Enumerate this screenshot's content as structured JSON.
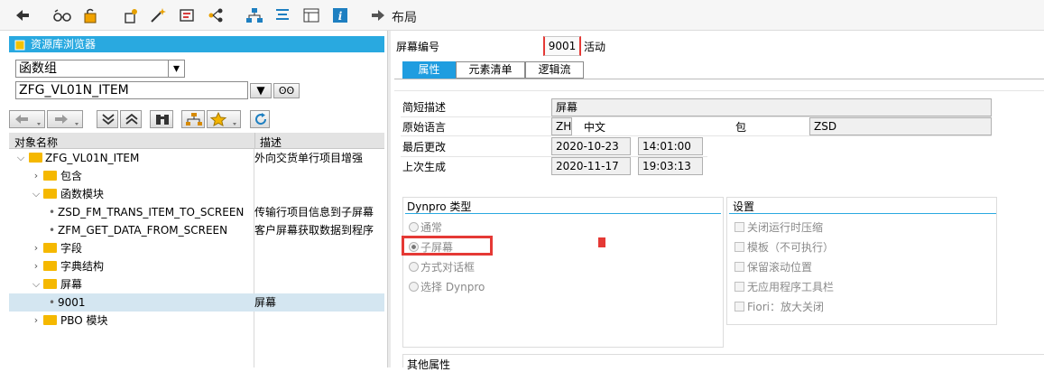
{
  "toolbar": {
    "layout_label": "布局"
  },
  "browser": {
    "title": "资源库浏览器",
    "object_type": "函数组",
    "object_name": "ZFG_VL01N_ITEM",
    "col_name": "对象名称",
    "col_desc": "描述"
  },
  "tree": {
    "root": {
      "name": "ZFG_VL01N_ITEM",
      "desc": "外向交货单行项目增强"
    },
    "includes": "包含",
    "function_modules": "函数模块",
    "fm1": {
      "name": "ZSD_FM_TRANS_ITEM_TO_SCREEN",
      "desc": "传输行项目信息到子屏幕"
    },
    "fm2": {
      "name": "ZFM_GET_DATA_FROM_SCREEN",
      "desc": "客户屏幕获取数据到程序"
    },
    "fields": "字段",
    "dict_structs": "字典结构",
    "screens": "屏幕",
    "screen1": {
      "name": "9001",
      "desc": "屏幕"
    },
    "pbo": "PBO 模块"
  },
  "screen": {
    "number_label": "屏幕编号",
    "number": "9001",
    "status": "活动"
  },
  "tabs": {
    "attributes": "属性",
    "elements": "元素清单",
    "flow_logic": "逻辑流"
  },
  "attributes": {
    "short_desc_label": "简短描述",
    "short_desc": "屏幕",
    "orig_lang_label": "原始语言",
    "orig_lang_code": "ZH",
    "orig_lang_name": "中文",
    "package_label": "包",
    "package": "ZSD",
    "last_changed_label": "最后更改",
    "last_changed_date": "2020-10-23",
    "last_changed_time": "14:01:00",
    "last_gen_label": "上次生成",
    "last_gen_date": "2020-11-17",
    "last_gen_time": "19:03:13"
  },
  "dynpro_type": {
    "title": "Dynpro 类型",
    "options": [
      "通常",
      "子屏幕",
      "方式对话框",
      "选择 Dynpro"
    ],
    "selected": "子屏幕"
  },
  "settings": {
    "title": "设置",
    "options": [
      "关闭运行时压缩",
      "模板（不可执行）",
      "保留滚动位置",
      "无应用程序工具栏",
      "Fiori：放大关闭"
    ]
  },
  "other_attributes": {
    "title": "其他属性"
  },
  "colors": {
    "title_bar": "#29a9e0",
    "highlight": "#e53935",
    "selected_row": "#d4e6f1"
  }
}
